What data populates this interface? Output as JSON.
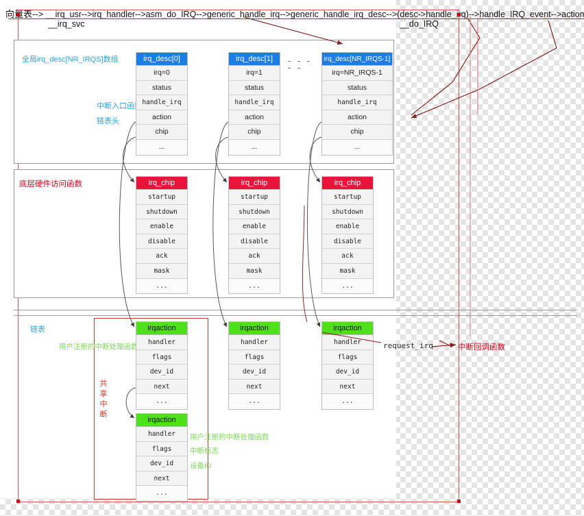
{
  "header": {
    "line1_zh": "向量表-->",
    "line1_chain": " __irq_usr-->irq_handler-->asm_do_IRQ-->generic_handle_irq-->generic_handle_irq_desc-->(desc->handle_irq)-->handle_IRQ_event-->action->handler",
    "line2_left": "__irq_svc",
    "line2_right": "__do_IRQ"
  },
  "labels": {
    "global_array": "全局irq_desc[NR_IRQS]数组",
    "irq_entry_fn": "中断入口函数",
    "list_head": "链表头",
    "low_level_hw": "底层硬件访问函数",
    "linked_list": "链表",
    "user_handler_1": "用户注册的中断处理函数",
    "user_handler_2": "用户注册的中断处理函数",
    "irq_flag": "中断标志",
    "device_id": "设备ID",
    "shared_irq": "共享中断",
    "request_irq": "request_irq",
    "irq_callback": "中断回调函数"
  },
  "irq_desc": [
    {
      "title": "irq_desc[0]",
      "rows": [
        "irq=0",
        "status",
        "handle_irq",
        "action",
        "chip",
        "..."
      ]
    },
    {
      "title": "irq_desc[1]",
      "rows": [
        "irq=1",
        "status",
        "handle_irq",
        "action",
        "chip",
        "..."
      ]
    },
    {
      "title": "irq_desc[NR_IRQS-1]",
      "rows": [
        "irq=NR_IRQS-1",
        "status",
        "handle_irq",
        "action",
        "chip",
        "..."
      ]
    }
  ],
  "dots_separator": "- - - - -",
  "irq_chip": [
    {
      "title": "irq_chip",
      "rows": [
        "startup",
        "shutdown",
        "enable",
        "disable",
        "ack",
        "mask",
        "..."
      ]
    },
    {
      "title": "irq_chip",
      "rows": [
        "startup",
        "shutdown",
        "enable",
        "disable",
        "ack",
        "mask",
        "..."
      ]
    },
    {
      "title": "irq_chip",
      "rows": [
        "startup",
        "shutdown",
        "enable",
        "disable",
        "ack",
        "mask",
        "..."
      ]
    }
  ],
  "irqaction": [
    {
      "title": "irqaction",
      "rows": [
        "handler",
        "flags",
        "dev_id",
        "next",
        "..."
      ]
    },
    {
      "title": "irqaction",
      "rows": [
        "handler",
        "flags",
        "dev_id",
        "next",
        "..."
      ]
    },
    {
      "title": "irqaction",
      "rows": [
        "handler",
        "flags",
        "dev_id",
        "next",
        "..."
      ]
    },
    {
      "title": "irqaction",
      "rows": [
        "handler",
        "flags",
        "dev_id",
        "next",
        "..."
      ]
    }
  ],
  "colors": {
    "desc_header": "#1a7de8",
    "chip_header": "#e8143c",
    "action_header": "#4ee01a",
    "frame_red": "#d9534f",
    "annotation_blue": "#29a3d6",
    "annotation_red": "#d0021b",
    "annotation_green": "#7ed957"
  }
}
